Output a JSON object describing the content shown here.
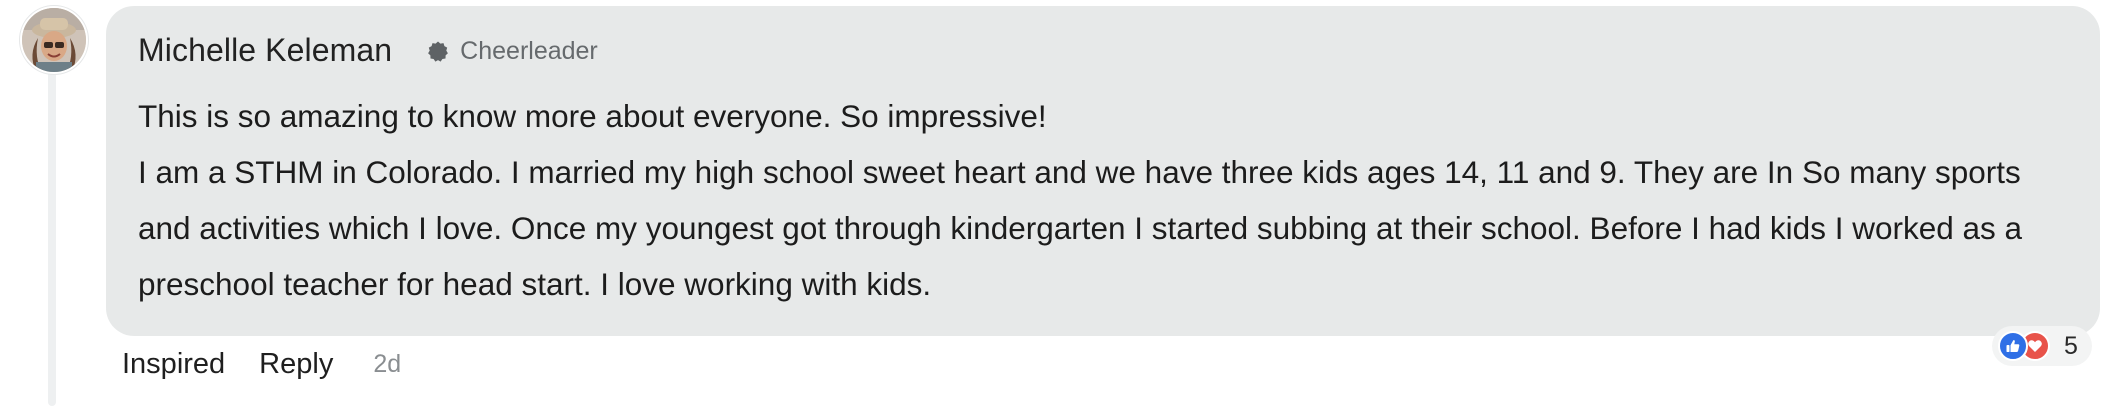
{
  "comment": {
    "author": "Michelle Keleman",
    "role": "Cheerleader",
    "paragraphs": [
      "This is so amazing to know more about everyone. So impressive!",
      "I am a STHM in Colorado. I married my high school sweet heart and we have three kids ages 14, 11 and 9. They are In So many sports and activities which I love. Once my youngest got through kindergarten I started subbing at their school. Before I had kids I worked as a preschool teacher for head start. I love working with kids."
    ],
    "actions": {
      "inspired_label": "Inspired",
      "reply_label": "Reply",
      "timestamp": "2d"
    },
    "reactions": {
      "icons": [
        "thumbs-up-icon",
        "heart-icon"
      ],
      "count": "5"
    }
  },
  "colors": {
    "bubble_bg": "#e7e9e9",
    "like_blue": "#2f6fe6",
    "love_red": "#e8534a",
    "muted_text": "#666a6d"
  }
}
